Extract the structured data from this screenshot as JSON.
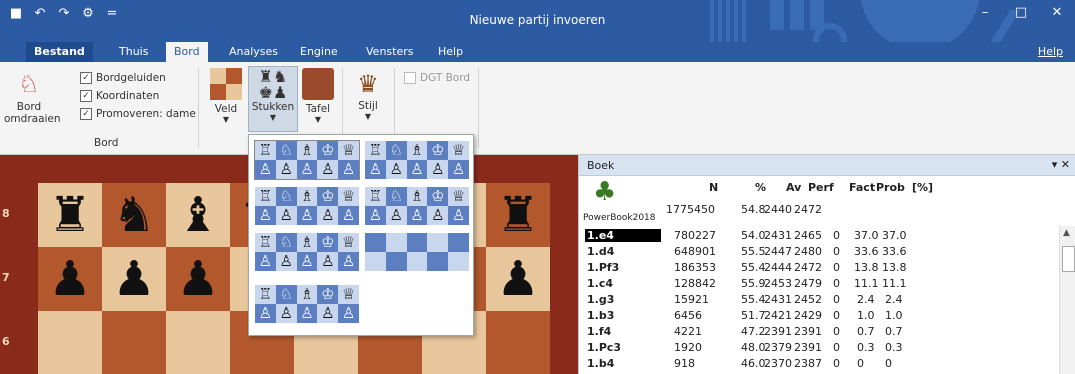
{
  "window": {
    "title": "Nieuwe partij invoeren",
    "quick_access": [
      "■",
      "↶",
      "↷",
      "⚙",
      "="
    ],
    "controls": [
      "–",
      "□",
      "✕"
    ]
  },
  "menu": {
    "tabs": [
      "Bestand",
      "Thuis",
      "Bord",
      "Analyses",
      "Engine",
      "Vensters",
      "Help"
    ],
    "active": "Bord",
    "help_link": "Help"
  },
  "ribbon": {
    "flip_label1": "Bord",
    "flip_label2": "omdraaien",
    "checkboxes": [
      "Bordgeluiden",
      "Koordinaten",
      "Promoveren: dame"
    ],
    "group_label": "Bord",
    "buttons": [
      "Veld",
      "Stukken",
      "Tafel",
      "Stijl"
    ],
    "dgt": "DGT Bord"
  },
  "board": {
    "ranks": [
      "8",
      "7",
      "6"
    ],
    "rank8": [
      "♜",
      "♞",
      "♝",
      "♛",
      "",
      "",
      "",
      "♜"
    ],
    "rank7": [
      "♟",
      "♟",
      "♟",
      "",
      "",
      "",
      "",
      "♟"
    ]
  },
  "piece_sets": [
    {
      "top": "♖♘♗♔♕",
      "bottom": "♙♙♙♙♙"
    },
    {
      "top": "♖♘♗♔♕",
      "bottom": "♙♙♙♙♙"
    },
    {
      "top": "♖♘♗♔♕",
      "bottom": "♙♙♙♙♙"
    },
    {
      "top": "♖♘♗♔♕",
      "bottom": "♙♙♙♙♙"
    },
    {
      "top": "♖♘♗♔♕",
      "bottom": "♙♙♙♙♙"
    },
    {
      "top": "",
      "bottom": ""
    },
    {
      "top": "♖♘♗♔♕",
      "bottom": "♙♙♙♙♙"
    }
  ],
  "book": {
    "title": "Boek",
    "controls": "▾ ✕",
    "source": "PowerBook2018",
    "headers": [
      "N",
      "%",
      "Av",
      "Perf",
      "Fact",
      "Prob",
      "[%]"
    ],
    "total": {
      "n": "1775450",
      "pct": "54.8",
      "av": "2440",
      "perf": "2472"
    },
    "rows": [
      {
        "move": "1.e4",
        "n": "780227",
        "pct": "54.0",
        "av": "2431",
        "perf": "2465",
        "fact": "0",
        "prob": "37.0",
        "p": "37.0"
      },
      {
        "move": "1.d4",
        "n": "648901",
        "pct": "55.5",
        "av": "2447",
        "perf": "2480",
        "fact": "0",
        "prob": "33.6",
        "p": "33.6"
      },
      {
        "move": "1.Pf3",
        "n": "186353",
        "pct": "55.4",
        "av": "2444",
        "perf": "2472",
        "fact": "0",
        "prob": "13.8",
        "p": "13.8"
      },
      {
        "move": "1.c4",
        "n": "128842",
        "pct": "55.9",
        "av": "2453",
        "perf": "2479",
        "fact": "0",
        "prob": "11.1",
        "p": "11.1"
      },
      {
        "move": "1.g3",
        "n": "15921",
        "pct": "55.4",
        "av": "2431",
        "perf": "2452",
        "fact": "0",
        "prob": "2.4",
        "p": "2.4"
      },
      {
        "move": "1.b3",
        "n": "6456",
        "pct": "51.7",
        "av": "2421",
        "perf": "2429",
        "fact": "0",
        "prob": "1.0",
        "p": "1.0"
      },
      {
        "move": "1.f4",
        "n": "4221",
        "pct": "47.2",
        "av": "2391",
        "perf": "2391",
        "fact": "0",
        "prob": "0.7",
        "p": "0.7"
      },
      {
        "move": "1.Pc3",
        "n": "1920",
        "pct": "48.0",
        "av": "2379",
        "perf": "2391",
        "fact": "0",
        "prob": "0.3",
        "p": "0.3"
      },
      {
        "move": "1.b4",
        "n": "918",
        "pct": "46.0",
        "av": "2370",
        "perf": "2387",
        "fact": "0",
        "prob": "0",
        "p": "0"
      }
    ]
  }
}
